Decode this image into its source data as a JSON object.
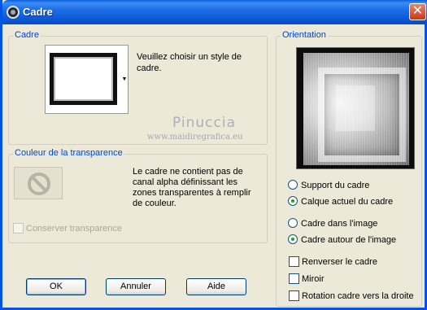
{
  "window": {
    "title": "Cadre",
    "close_label": "✕"
  },
  "frame_group": {
    "label": "Cadre",
    "help_text": "Veuillez choisir un style de cadre.",
    "arrow": "▼"
  },
  "watermark": {
    "name": "Pinuccia",
    "url": "www.maidiregrafica.eu"
  },
  "transparency_group": {
    "label": "Couleur de la transparence",
    "message": "Le cadre ne contient pas de canal alpha définissant les zones transparentes à remplir de couleur.",
    "preserve_checkbox": {
      "label": "Conserver transparence",
      "checked": false,
      "enabled": false
    }
  },
  "orientation_group": {
    "label": "Orientation",
    "radios_apply": [
      {
        "label": "Support du cadre",
        "selected": false
      },
      {
        "label": "Calque actuel du cadre",
        "selected": true
      }
    ],
    "radios_position": [
      {
        "label": "Cadre dans l'image",
        "selected": false
      },
      {
        "label": "Cadre autour de l'image",
        "selected": true
      }
    ],
    "checkboxes": [
      {
        "label": "Renverser le cadre",
        "checked": false
      },
      {
        "label": "Miroir",
        "checked": false
      },
      {
        "label": "Rotation cadre vers la droite",
        "checked": false
      }
    ]
  },
  "buttons": {
    "ok": "OK",
    "cancel": "Annuler",
    "help": "Aide"
  },
  "colors": {
    "title_bar": "#0c56d4",
    "group_label": "#0046d5",
    "dialog_bg": "#ece9d8",
    "close_button": "#c8391b"
  }
}
